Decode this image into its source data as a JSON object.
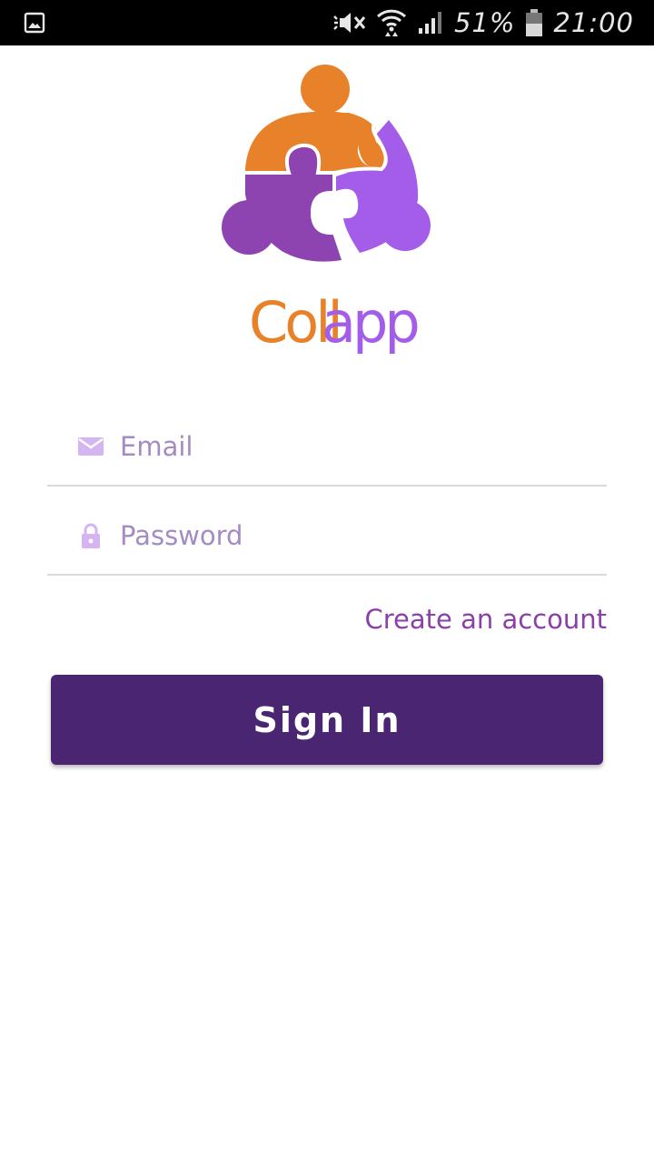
{
  "status_bar": {
    "battery_text": "51%",
    "time": "21:00",
    "icons": [
      "gallery-icon",
      "mute-icon",
      "wifi-icon",
      "signal-icon",
      "battery-icon"
    ]
  },
  "logo": {
    "brand_name": "Collapp",
    "colors": {
      "orange": "#e8822a",
      "purple": "#8e44b0",
      "light_purple": "#a35de8"
    }
  },
  "form": {
    "email_placeholder": "Email",
    "password_placeholder": "Password",
    "create_account_label": "Create an account",
    "sign_in_label": "Sign In",
    "icons": [
      "email-icon",
      "lock-icon"
    ]
  },
  "colors": {
    "primary": "#4a2572",
    "link": "#8b3fa8",
    "placeholder": "#a58bc4",
    "icon": "#d5b4f2",
    "divider": "#d9d9d9"
  }
}
